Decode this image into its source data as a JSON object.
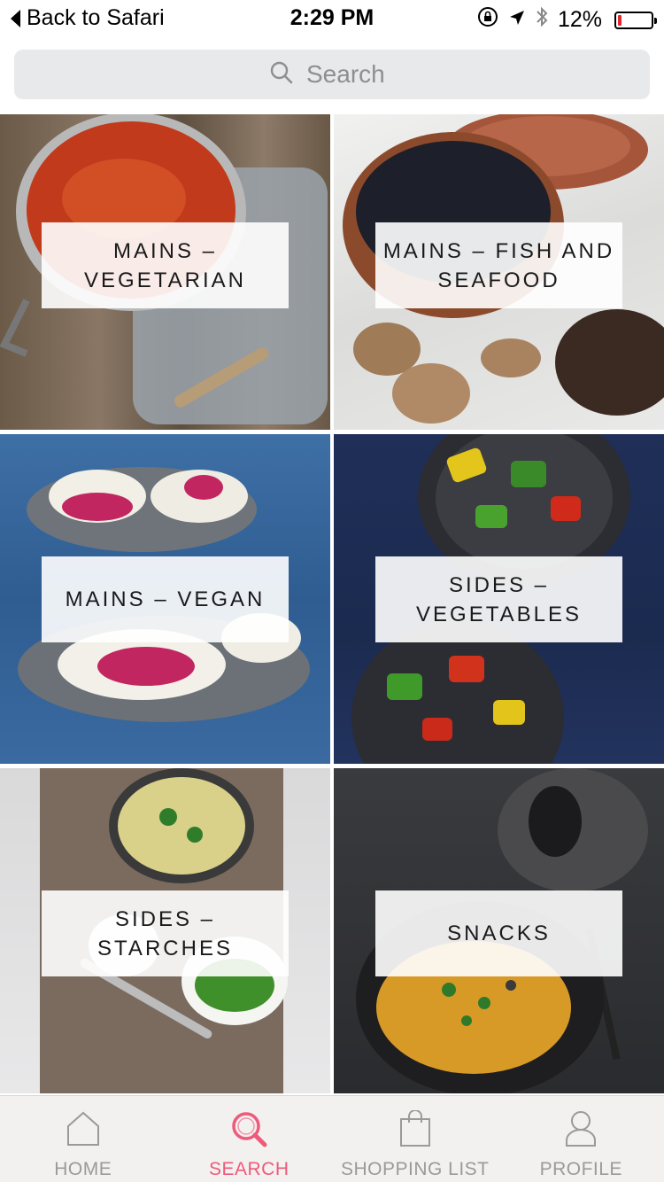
{
  "status_bar": {
    "back_label": "Back to Safari",
    "time": "2:29 PM",
    "battery": "12%",
    "battery_level": 0.12,
    "icons": [
      "orientation-lock-icon",
      "location-arrow-icon",
      "bluetooth-icon",
      "battery-icon"
    ]
  },
  "search": {
    "placeholder": "Search"
  },
  "categories": [
    {
      "label": "MAINS – VEGETARIAN"
    },
    {
      "label": "MAINS – FISH AND SEAFOOD"
    },
    {
      "label": "MAINS – VEGAN"
    },
    {
      "label": "SIDES – VEGETABLES"
    },
    {
      "label": "SIDES – STARCHES"
    },
    {
      "label": "SNACKS"
    }
  ],
  "tab_bar": {
    "tabs": [
      {
        "label": "HOME",
        "icon": "home-icon"
      },
      {
        "label": "SEARCH",
        "icon": "search-icon",
        "active": true
      },
      {
        "label": "SHOPPING LIST",
        "icon": "shopping-bag-icon"
      },
      {
        "label": "PROFILE",
        "icon": "profile-icon"
      }
    ],
    "active_color": "#ee5a79",
    "inactive_color": "#9a9a9a"
  }
}
